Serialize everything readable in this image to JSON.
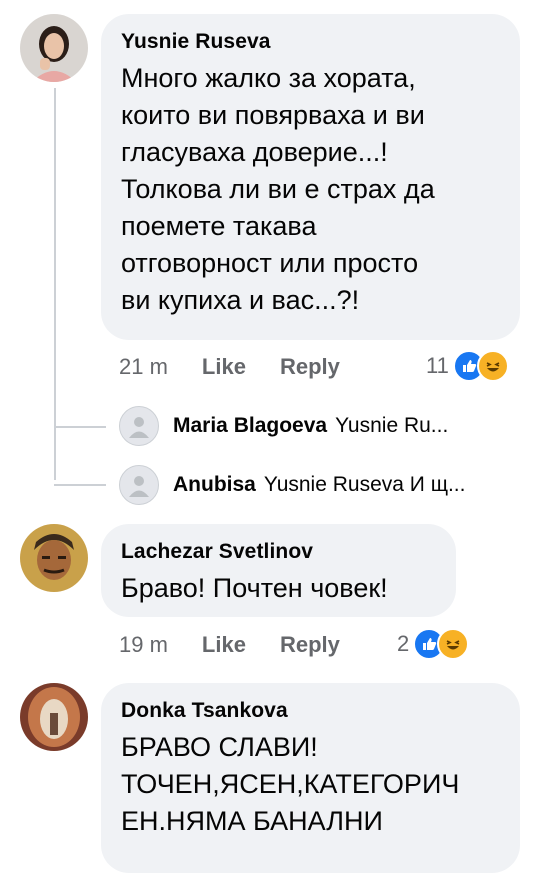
{
  "comments": [
    {
      "author": "Yusnie Ruseva",
      "text": "Много жалко за хората,\nкоито ви повярваха и ви\nгласуваха доверие...!\nТолкова ли ви е страх да\nпоемете такава\nотговорност или просто\nви купиха и вас...?!",
      "time": "21 m",
      "like_label": "Like",
      "reply_label": "Reply",
      "reaction_count": "11",
      "reactions": [
        "like-icon",
        "haha-icon"
      ],
      "replies": [
        {
          "author": "Maria Blagoeva",
          "snippet": "Yusnie Ru..."
        },
        {
          "author": "Anubisa",
          "snippet": "Yusnie Ruseva И щ..."
        }
      ]
    },
    {
      "author": "Lachezar Svetlinov",
      "text": "Браво! Почтен човек!",
      "time": "19 m",
      "like_label": "Like",
      "reply_label": "Reply",
      "reaction_count": "2",
      "reactions": [
        "like-icon",
        "haha-icon"
      ]
    },
    {
      "author": "Donka Tsankova",
      "text": "БРАВО СЛАВИ!\nТОЧЕН,ЯСЕН,КАТЕГОРИЧ\nЕН.НЯМА БАНАЛНИ"
    }
  ],
  "colors": {
    "bubble": "#f0f2f5",
    "meta_text": "#65676b",
    "like_blue": "#1877f2",
    "haha_yellow": "#f7b125"
  }
}
